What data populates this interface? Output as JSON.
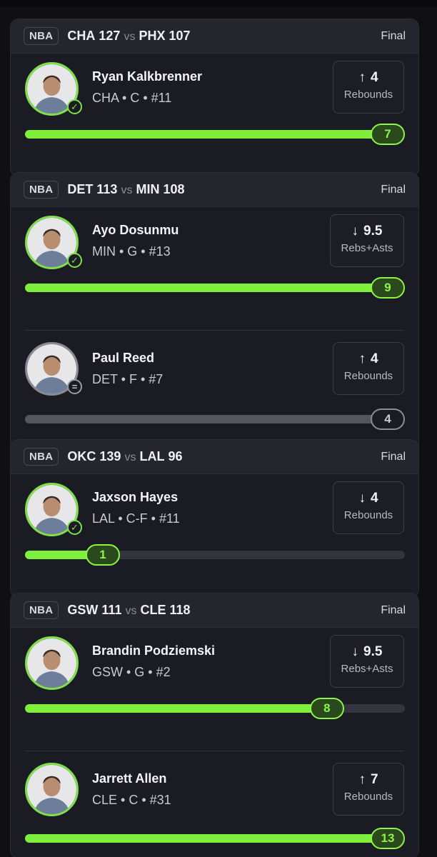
{
  "colors": {
    "accent": "#7ef03c",
    "card": "#1b1b23",
    "header": "#25252e",
    "neutral": "#8c8c96"
  },
  "games": [
    {
      "league": "NBA",
      "home": {
        "team": "CHA",
        "score": "127"
      },
      "vs": "vs",
      "away": {
        "team": "PHX",
        "score": "107"
      },
      "status": "Final",
      "players": [
        {
          "name": "Ryan Kalkbrenner",
          "meta": "CHA • C • #11",
          "direction": "up",
          "arrow": "↑",
          "line": "4",
          "stat": "Rebounds",
          "result": "7",
          "progress": 1.0,
          "hit": true
        }
      ]
    },
    {
      "league": "NBA",
      "home": {
        "team": "DET",
        "score": "113"
      },
      "vs": "vs",
      "away": {
        "team": "MIN",
        "score": "108"
      },
      "status": "Final",
      "players": [
        {
          "name": "Ayo Dosunmu",
          "meta": "MIN • G • #13",
          "direction": "down",
          "arrow": "↓",
          "line": "9.5",
          "stat": "Rebs+Asts",
          "result": "9",
          "progress": 1.0,
          "hit": true
        },
        {
          "name": "Paul Reed",
          "meta": "DET • F • #7",
          "direction": "up",
          "arrow": "↑",
          "line": "4",
          "stat": "Rebounds",
          "result": "4",
          "progress": 1.0,
          "hit": false
        }
      ]
    },
    {
      "league": "NBA",
      "home": {
        "team": "OKC",
        "score": "139"
      },
      "vs": "vs",
      "away": {
        "team": "LAL",
        "score": "96"
      },
      "status": "Final",
      "players": [
        {
          "name": "Jaxson Hayes",
          "meta": "LAL • C-F • #11",
          "direction": "down",
          "arrow": "↓",
          "line": "4",
          "stat": "Rebounds",
          "result": "1",
          "progress": 0.25,
          "hit": true
        }
      ]
    },
    {
      "league": "NBA",
      "home": {
        "team": "GSW",
        "score": "111"
      },
      "vs": "vs",
      "away": {
        "team": "CLE",
        "score": "118"
      },
      "status": "Final",
      "players": [
        {
          "name": "Brandin Podziemski",
          "meta": "GSW • G • #2",
          "direction": "down",
          "arrow": "↓",
          "line": "9.5",
          "stat": "Rebs+Asts",
          "result": "8",
          "progress": 0.84,
          "hit": true
        },
        {
          "name": "Jarrett Allen",
          "meta": "CLE • C • #31",
          "direction": "up",
          "arrow": "↑",
          "line": "7",
          "stat": "Rebounds",
          "result": "13",
          "progress": 1.0,
          "hit": true
        }
      ]
    }
  ]
}
